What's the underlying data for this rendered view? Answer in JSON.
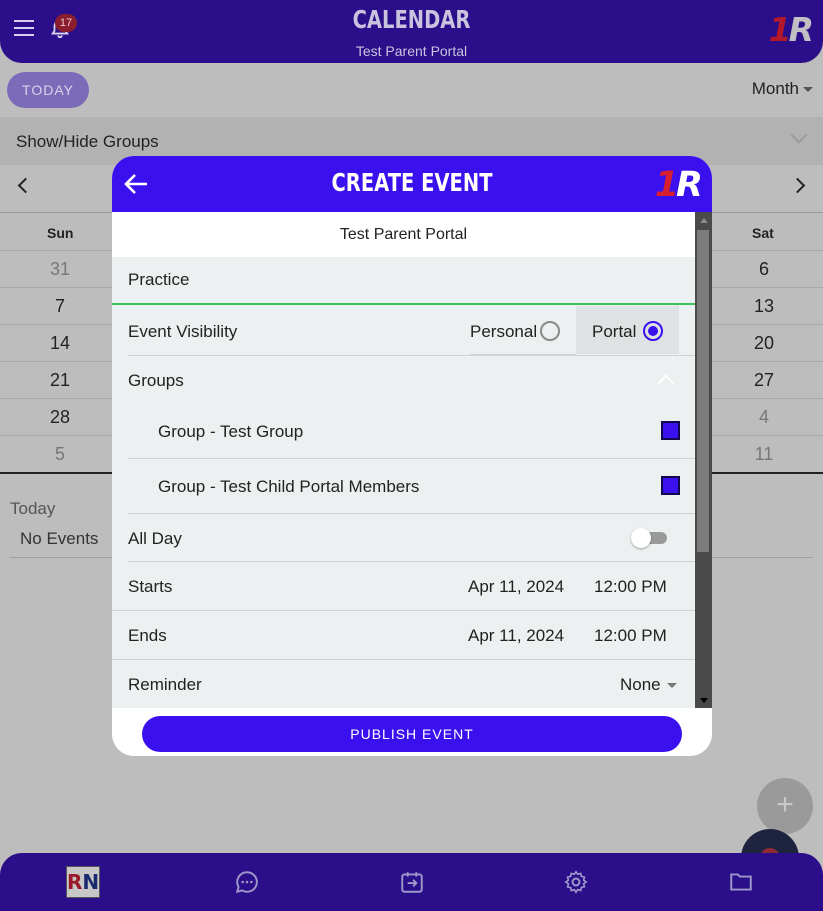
{
  "header": {
    "title": "CALENDAR",
    "subtitle": "Test Parent Portal",
    "notification_count": "17",
    "logo_one": "1",
    "logo_r": "R"
  },
  "toolbar": {
    "today_label": "TODAY",
    "view_label": "Month"
  },
  "groups_toggle": {
    "label": "Show/Hide Groups"
  },
  "calendar": {
    "day_names": [
      "Sun",
      "Sat"
    ],
    "weeks": [
      {
        "sun": "31",
        "sat": "6"
      },
      {
        "sun": "7",
        "sat": "13"
      },
      {
        "sun": "14",
        "sat": "20"
      },
      {
        "sun": "21",
        "sat": "27"
      },
      {
        "sun": "28",
        "sat": "4"
      },
      {
        "sun": "5",
        "sat": "11"
      }
    ]
  },
  "events_panel": {
    "heading": "Today",
    "empty_text": "No Events"
  },
  "bottom_nav": {
    "logo_r": "R",
    "logo_n": "N"
  },
  "fab": {
    "add_symbol": "+"
  },
  "modal": {
    "title": "CREATE EVENT",
    "portal_name": "Test Parent Portal",
    "event_title_value": "Practice",
    "visibility": {
      "label": "Event Visibility",
      "options": [
        "Personal",
        "Portal"
      ],
      "selected": "Portal"
    },
    "groups": {
      "label": "Groups",
      "items": [
        {
          "label": "Group - Test Group",
          "checked": true
        },
        {
          "label": "Group - Test Child Portal Members",
          "checked": true
        }
      ]
    },
    "all_day": {
      "label": "All Day",
      "on": false
    },
    "starts": {
      "label": "Starts",
      "date": "Apr 11, 2024",
      "time": "12:00 PM"
    },
    "ends": {
      "label": "Ends",
      "date": "Apr 11, 2024",
      "time": "12:00 PM"
    },
    "reminder": {
      "label": "Reminder",
      "value": "None"
    },
    "publish_label": "PUBLISH EVENT"
  },
  "colors": {
    "brand_purple": "#3a10ee",
    "header_purple_dimmed": "#2a0e8a",
    "input_underline": "#3dbf5a",
    "modal_bg": "#edf0f0"
  }
}
